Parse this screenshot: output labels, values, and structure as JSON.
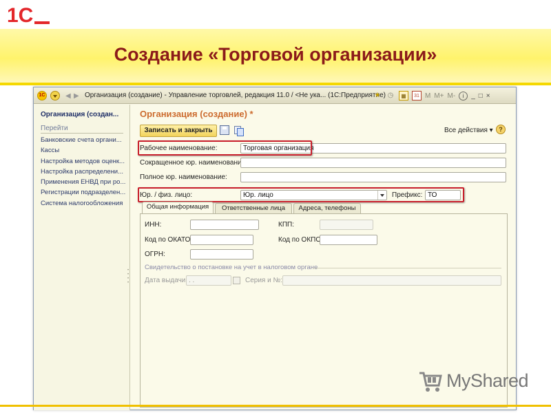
{
  "slide": {
    "logo_text": "1С",
    "title": "Создание «Торговой организации»",
    "watermark": "MyShared"
  },
  "window": {
    "title": "Организация (создание) - Управление торговлей, редакция 11.0 / <Не ука...  (1С:Предприятие)",
    "icons": [
      "1c-logo-icon",
      "main-menu-dropdown-icon",
      "back-arrow-icon",
      "forward-arrow-icon",
      "favorite-star-icon",
      "history-icon",
      "calculator-icon",
      "calendar-icon"
    ],
    "memory_buttons": [
      "M",
      "M+",
      "M-"
    ],
    "info_label": "i",
    "window_controls": [
      "_",
      "□",
      "×"
    ]
  },
  "sidebar": {
    "title": "Организация (создан...",
    "go_label": "Перейти",
    "items": [
      "Банковские счета органи...",
      "Кассы",
      "Настройка методов оценк...",
      "Настройка распределени...",
      "Применения ЕНВД при ро...",
      "Регистрации подразделен...",
      "Система налогообложения"
    ]
  },
  "form": {
    "title": "Организация (создание) *",
    "save_close_label": "Записать и закрыть",
    "all_actions_label": "Все действия ▾",
    "help_label": "?",
    "fields": {
      "work_name_label": "Рабочее наименование:",
      "work_name_value": "Торговая организация",
      "short_name_label": "Сокращенное юр. наименование:",
      "short_name_value": "",
      "full_name_label": "Полное юр. наименование:",
      "full_name_value": "",
      "entity_type_label": "Юр. / физ. лицо:",
      "entity_type_value": "Юр. лицо",
      "prefix_label": "Префикс:",
      "prefix_value": "ТО"
    },
    "tabs": [
      "Общая информация",
      "Ответственные лица",
      "Адреса, телефоны"
    ],
    "active_tab": "Общая информация",
    "general": {
      "inn_label": "ИНН:",
      "kpp_label": "КПП:",
      "okato_label": "Код по ОКАТО:",
      "okpo_label": "Код по ОКПО:",
      "ogrn_label": "ОГРН:",
      "certificate_caption": "Свидетельство о постановке на учет в налоговом органе",
      "issue_date_label": "Дата выдачи:",
      "issue_date_value": " .  .",
      "series_label": "Серия и №:"
    }
  },
  "colors": {
    "banner_yellow": "#fff36c",
    "title_red": "#8b1a1a",
    "form_title_orange": "#cc6b2e",
    "highlight_red": "#c81e2b",
    "window_bg": "#fbfae9"
  }
}
